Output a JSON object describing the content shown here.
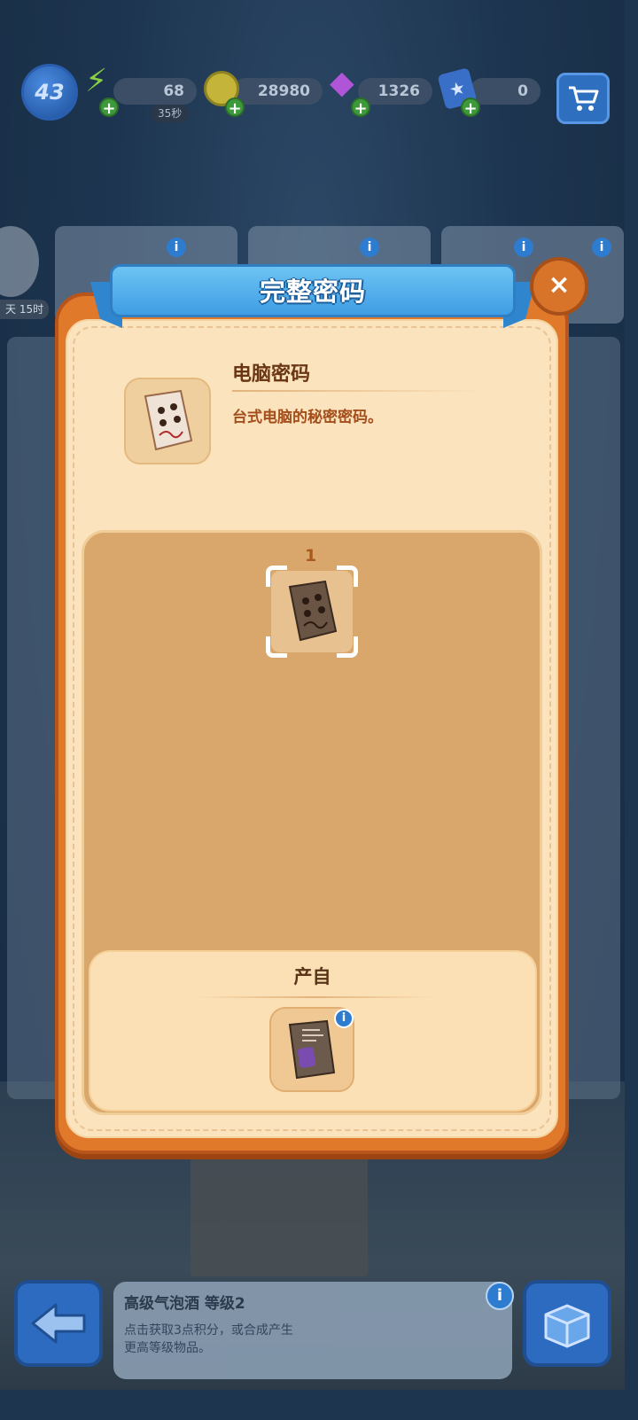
{
  "hud": {
    "level": "43",
    "energy": "68",
    "energy_timer": "35秒",
    "coins": "28980",
    "gems": "1326",
    "stars": "0",
    "plus_symbol": "+"
  },
  "background": {
    "timer_label": "天 15时",
    "info_symbol": "i"
  },
  "dialog": {
    "title": "完整密码",
    "close_symbol": "×",
    "item_name": "电脑密码",
    "item_description": "台式电脑的秘密密码。",
    "piece_count": "1",
    "source_title": "产自",
    "source_info_symbol": "i"
  },
  "bottom_bar": {
    "item_title": "高级气泡酒 等级2",
    "item_desc": "点击获取3点积分，或合成产生更高等级物品。",
    "info_symbol": "i"
  },
  "icons": {
    "energy": "lightning-icon",
    "coins": "coin-icon",
    "gems": "gem-icon",
    "stars": "star-card-icon",
    "cart": "cart-icon",
    "back": "back-arrow-icon",
    "inventory": "box-icon"
  }
}
